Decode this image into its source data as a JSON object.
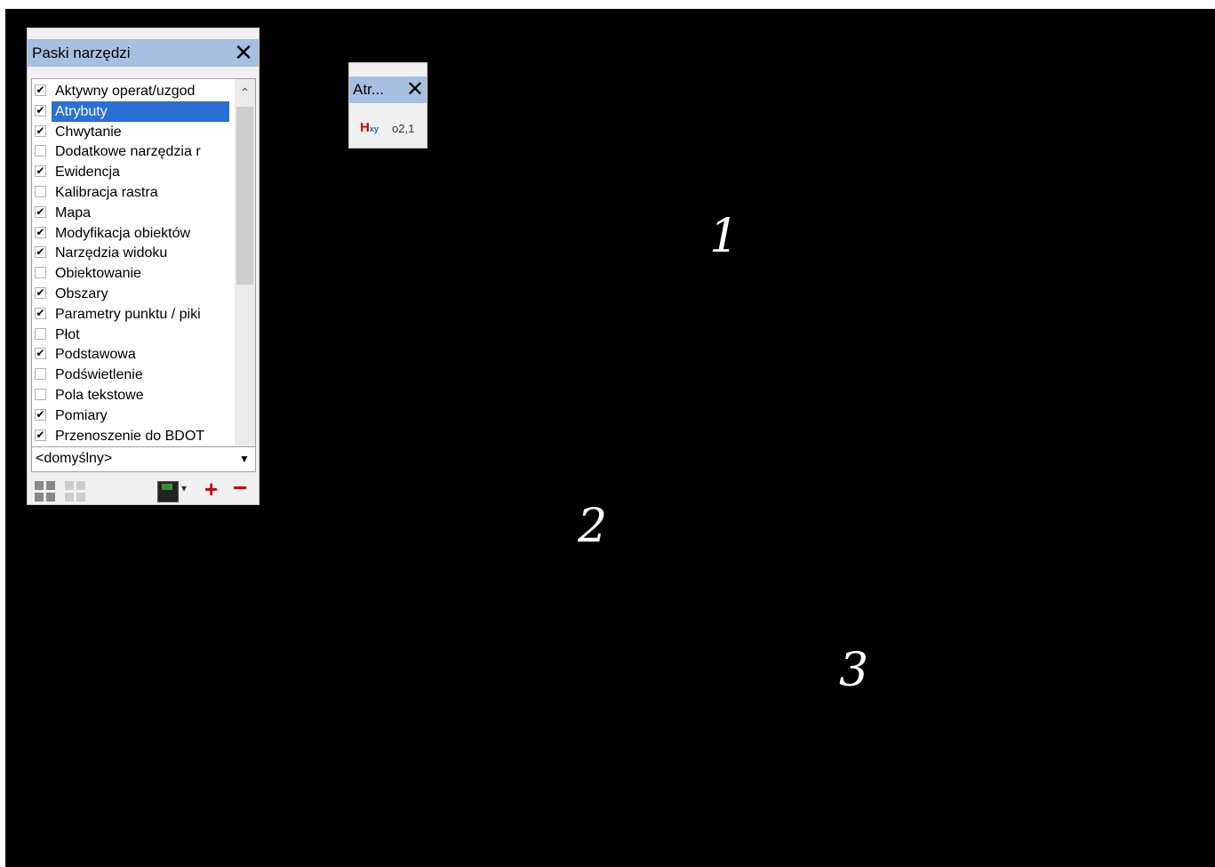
{
  "toolbar_panel": {
    "title": "Paski narzędzi",
    "close": "✕",
    "items": [
      {
        "label": "Aktywny operat/uzgod",
        "checked": true
      },
      {
        "label": "Atrybuty",
        "checked": true,
        "selected": true
      },
      {
        "label": "Chwytanie",
        "checked": true
      },
      {
        "label": "Dodatkowe narzędzia r",
        "checked": false
      },
      {
        "label": "Ewidencja",
        "checked": true
      },
      {
        "label": "Kalibracja rastra",
        "checked": false
      },
      {
        "label": "Mapa",
        "checked": true
      },
      {
        "label": "Modyfikacja obiektów",
        "checked": true
      },
      {
        "label": "Narzędzia widoku",
        "checked": true
      },
      {
        "label": "Obiektowanie",
        "checked": false
      },
      {
        "label": "Obszary",
        "checked": true
      },
      {
        "label": "Parametry punktu / piki",
        "checked": true
      },
      {
        "label": "Płot",
        "checked": false
      },
      {
        "label": "Podstawowa",
        "checked": true
      },
      {
        "label": "Podświetlenie",
        "checked": false
      },
      {
        "label": "Pola tekstowe",
        "checked": false
      },
      {
        "label": "Pomiary",
        "checked": true
      },
      {
        "label": "Przenoszenie do BDOT",
        "checked": true
      }
    ],
    "preset": "<domyślny>",
    "checkmark": "✔"
  },
  "atr_toolbar": {
    "title": "Atr...",
    "close": "✕",
    "h_label": "H",
    "h_sub": "xy",
    "coord_label": "o2,1"
  },
  "canvas_labels": [
    "1",
    "2",
    "3"
  ]
}
